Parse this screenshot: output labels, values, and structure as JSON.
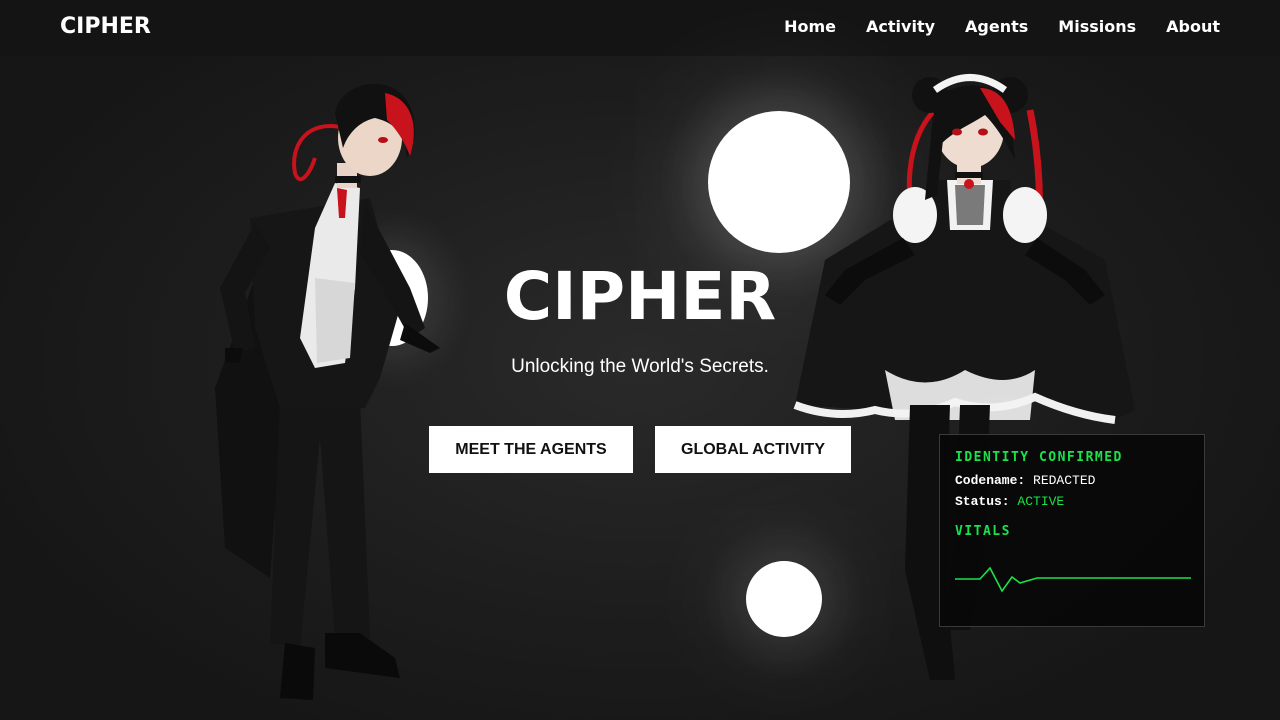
{
  "nav": {
    "brand": "CIPHER",
    "links": [
      {
        "label": "Home"
      },
      {
        "label": "Activity"
      },
      {
        "label": "Agents"
      },
      {
        "label": "Missions"
      },
      {
        "label": "About"
      }
    ]
  },
  "hero": {
    "title": "CIPHER",
    "subtitle": "Unlocking the World's Secrets.",
    "buttons": {
      "agents": "MEET THE AGENTS",
      "activity": "GLOBAL ACTIVITY"
    }
  },
  "identity_panel": {
    "heading": "IDENTITY CONFIRMED",
    "codename_label": "Codename:",
    "codename_value": "REDACTED",
    "status_label": "Status:",
    "status_value": "ACTIVE",
    "vitals_heading": "VITALS"
  },
  "colors": {
    "accent_green": "#19e34a",
    "background": "#1b1b1b",
    "nav_background": "#141414",
    "button_background": "#ffffff",
    "character_accent_red": "#d0101b"
  }
}
